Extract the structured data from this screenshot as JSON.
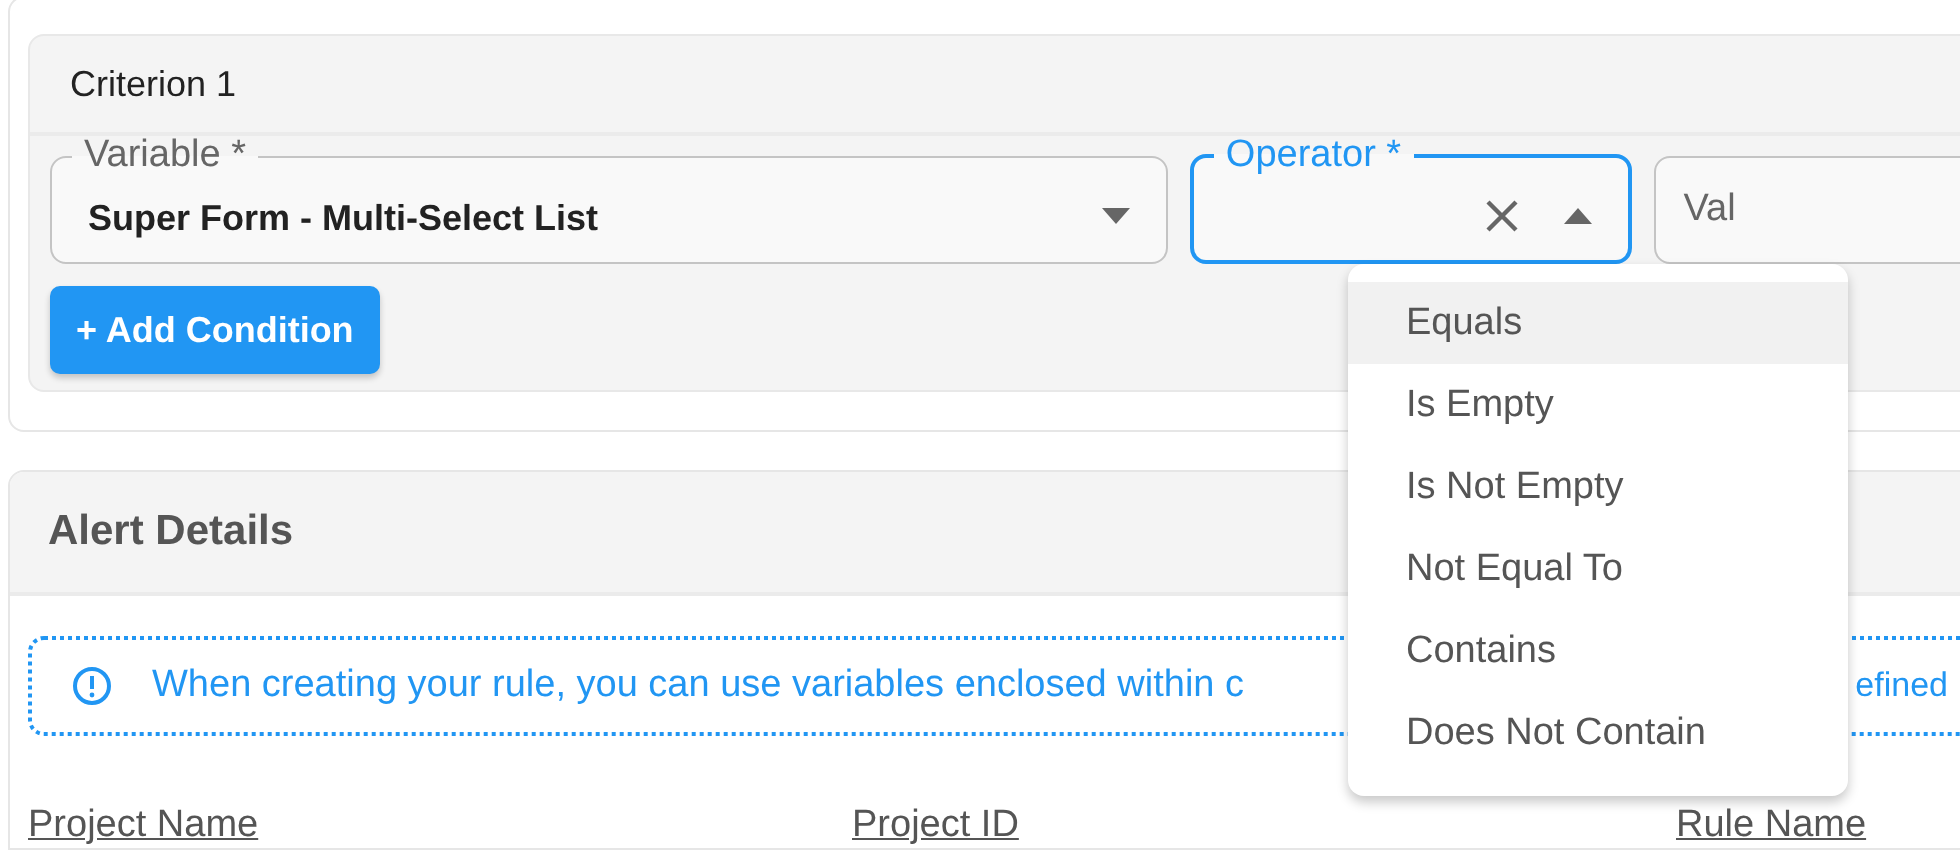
{
  "criterion": {
    "title": "Criterion 1",
    "fields": [
      {
        "kind": "select",
        "label": "Variable *",
        "value": "Super Form - Multi-Select List",
        "focused": false
      },
      {
        "kind": "select",
        "label": "Operator *",
        "focused": true,
        "clearable": true
      },
      {
        "kind": "text",
        "placeholder": "Val",
        "focused": false
      }
    ],
    "add_button": "+ Add Condition"
  },
  "operator_menu": {
    "options": [
      {
        "label": "Equals",
        "selected": true
      },
      {
        "label": "Is Empty",
        "selected": false
      },
      {
        "label": "Is Not Empty",
        "selected": false
      },
      {
        "label": "Not Equal To",
        "selected": false
      },
      {
        "label": "Contains",
        "selected": false
      },
      {
        "label": "Does Not Contain",
        "selected": false
      }
    ]
  },
  "alert_details": {
    "title": "Alert Details",
    "info": [
      "When creating your rule, you can use variables enclosed within c",
      "efined"
    ],
    "columns": [
      "Project Name",
      "Project ID",
      "Rule Name"
    ]
  }
}
